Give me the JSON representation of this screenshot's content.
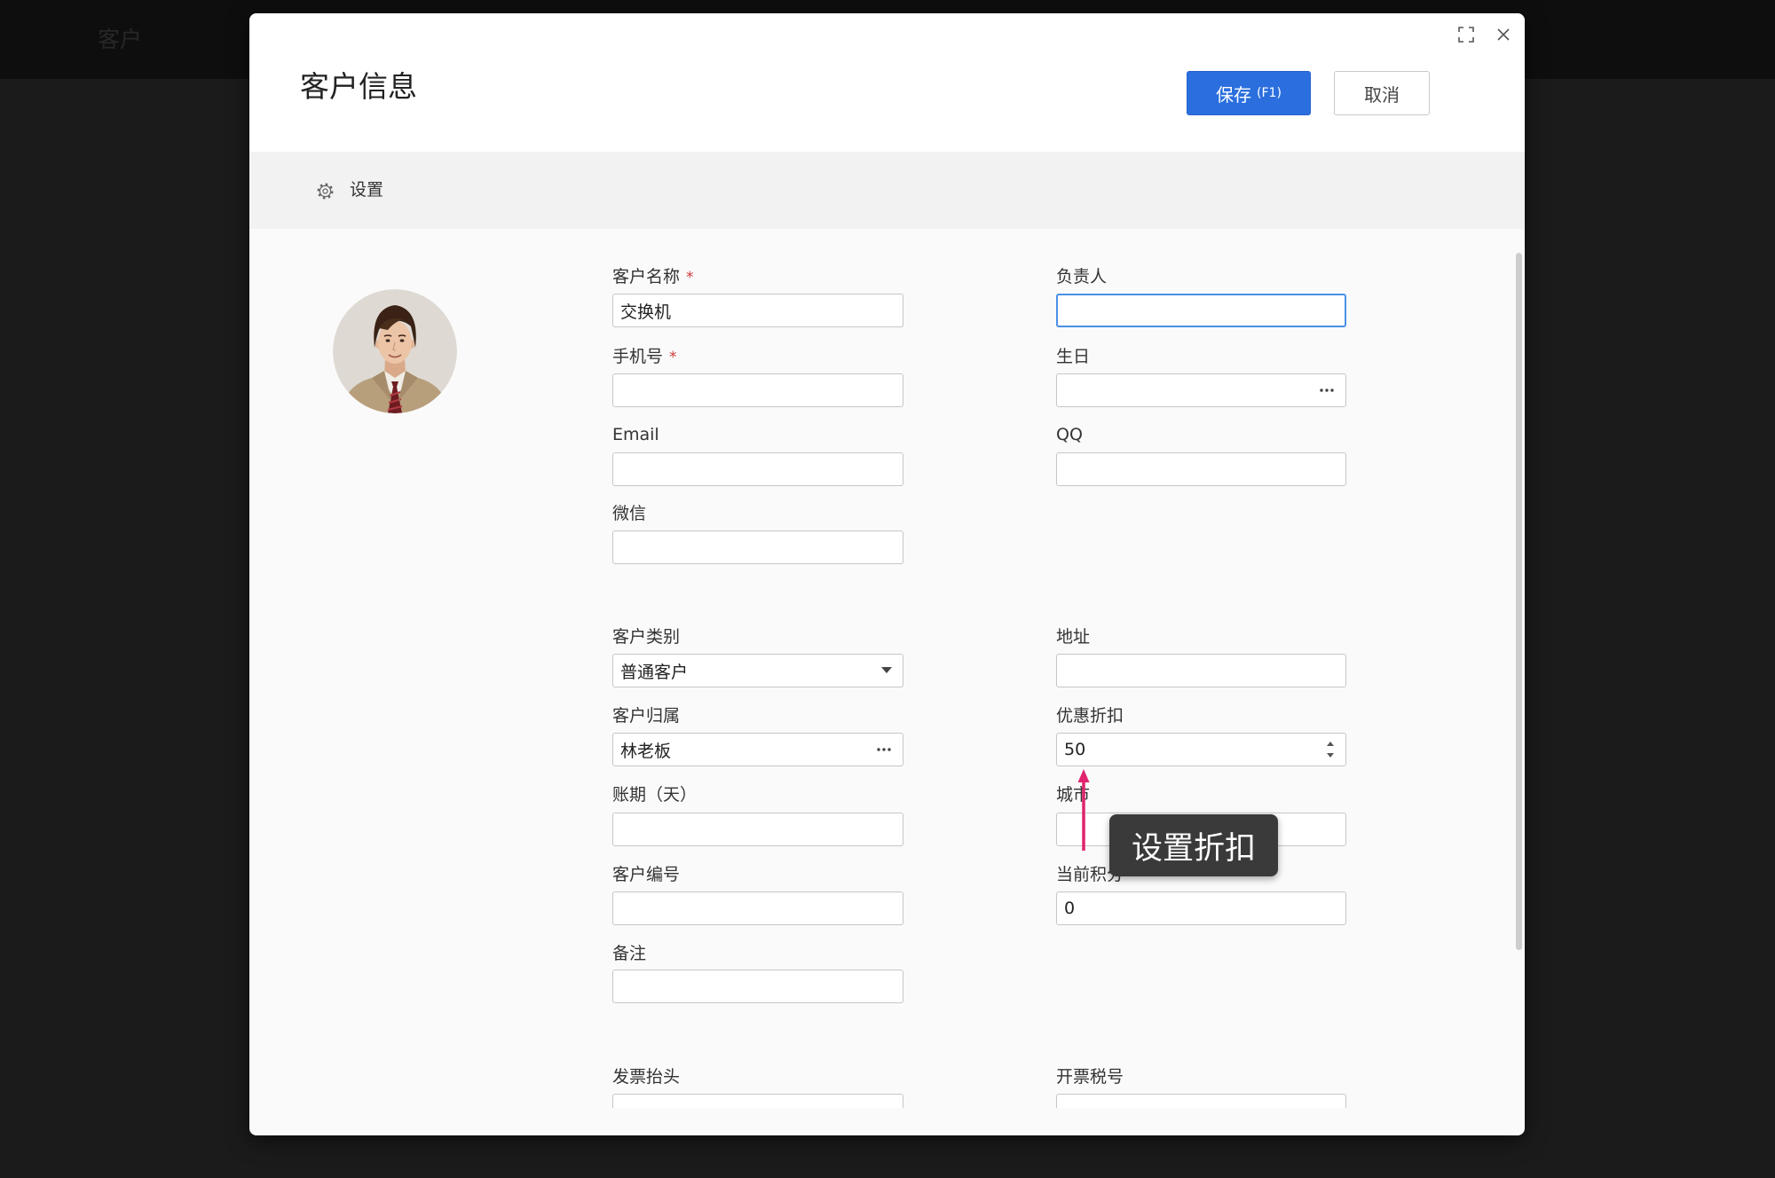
{
  "backdrop": {
    "app_title": "客户"
  },
  "modal": {
    "title": "客户信息",
    "save_label": "保存",
    "save_shortcut": "(F1)",
    "cancel_label": "取消",
    "window_icons": [
      "expand-icon",
      "close-icon"
    ]
  },
  "settings_bar": {
    "icon": "gear-icon",
    "label": "设置"
  },
  "avatar": {
    "icon": "customer-avatar-photo"
  },
  "form": {
    "required_mark": "*",
    "customer_name": {
      "label": "客户名称",
      "required": true,
      "value": "交换机"
    },
    "mobile": {
      "label": "手机号",
      "required": true,
      "value": ""
    },
    "email": {
      "label": "Email",
      "value": ""
    },
    "wechat": {
      "label": "微信",
      "value": ""
    },
    "customer_type": {
      "label": "客户类别",
      "value": "普通客户",
      "suffix_icon": "dropdown-arrow-icon"
    },
    "customer_owner": {
      "label": "客户归属",
      "value": "林老板",
      "suffix_icon": "more-icon"
    },
    "payment_term": {
      "label": "账期（天）",
      "value": ""
    },
    "customer_code": {
      "label": "客户编号",
      "value": ""
    },
    "remark": {
      "label": "备注",
      "value": ""
    },
    "invoice_title": {
      "label": "发票抬头",
      "value": ""
    },
    "manager": {
      "label": "负责人",
      "value": "",
      "focused": true
    },
    "birthday": {
      "label": "生日",
      "value": "",
      "suffix_icon": "more-icon"
    },
    "qq": {
      "label": "QQ",
      "value": ""
    },
    "address": {
      "label": "地址",
      "value": ""
    },
    "discount": {
      "label": "优惠折扣",
      "value": "50",
      "suffix_icon": "spinner-arrows-icon"
    },
    "city": {
      "label": "城市",
      "value": ""
    },
    "points": {
      "label": "当前积分",
      "value": "0"
    },
    "tax_number": {
      "label": "开票税号",
      "value": ""
    }
  },
  "annotation": {
    "text": "设置折扣",
    "arrow_icon": "pointer-arrow-icon"
  },
  "colors": {
    "primary": "#2b6fde",
    "required": "#d33a3a",
    "focus_border": "#4b90e6",
    "annotation_arrow": "#e0246e",
    "tooltip_bg": "#3a3a3a",
    "backdrop": "#1b1b1b"
  }
}
